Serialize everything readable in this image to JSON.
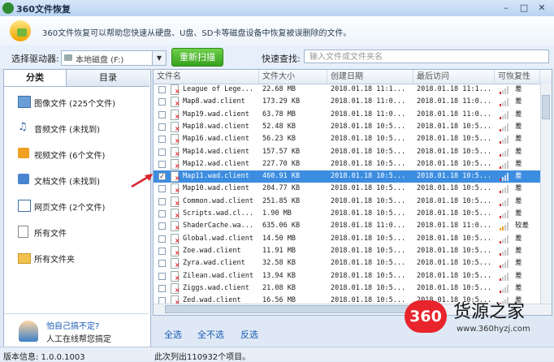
{
  "window": {
    "title": "360文件恢复",
    "min": "–",
    "max": "□",
    "close": "✕"
  },
  "banner": {
    "description": "360文件恢复可以帮助您快速从硬盘、U盘、SD卡等磁盘设备中恢复被误删除的文件。"
  },
  "toolbar": {
    "drive_label": "选择驱动器:",
    "drive_value": "本地磁盘  (F:)",
    "rescan": "重新扫描",
    "search_label": "快速查找:",
    "search_placeholder": "输入文件或文件夹名"
  },
  "tabs": [
    "分类",
    "目录"
  ],
  "categories": [
    {
      "label": "图像文件 (225个文件)",
      "icon": "image-icon"
    },
    {
      "label": "音频文件 (未找到)",
      "icon": "music-icon"
    },
    {
      "label": "视频文件 (6个文件)",
      "icon": "video-icon"
    },
    {
      "label": "文档文件 (未找到)",
      "icon": "document-icon"
    },
    {
      "label": "网页文件 (2个文件)",
      "icon": "webpage-icon"
    },
    {
      "label": "所有文件",
      "icon": "file-icon"
    },
    {
      "label": "所有文件夹",
      "icon": "folder-icon"
    }
  ],
  "help": {
    "question": "怕自己搞不定?",
    "answer": "人工在线帮您搞定"
  },
  "table": {
    "columns": [
      "文件名",
      "文件大小",
      "创建日期",
      "最后访问",
      "可恢复性"
    ],
    "rows": [
      {
        "name": "League of Lege...",
        "size": "22.68 MB",
        "created": "2018.01.18 11:1...",
        "accessed": "2018.01.18 11:1...",
        "rec": "差",
        "checked": false
      },
      {
        "name": "Map8.wad.client",
        "size": "173.29 KB",
        "created": "2018.01.18 11:0...",
        "accessed": "2018.01.18 11:0...",
        "rec": "差",
        "checked": false
      },
      {
        "name": "Map19.wad.client",
        "size": "63.78 MB",
        "created": "2018.01.18 11:0...",
        "accessed": "2018.01.18 11:0...",
        "rec": "差",
        "checked": false
      },
      {
        "name": "Map18.wad.client",
        "size": "52.48 KB",
        "created": "2018.01.18 10:5...",
        "accessed": "2018.01.18 10:5...",
        "rec": "差",
        "checked": false
      },
      {
        "name": "Map16.wad.client",
        "size": "56.23 KB",
        "created": "2018.01.18 10:5...",
        "accessed": "2018.01.18 10:5...",
        "rec": "差",
        "checked": false
      },
      {
        "name": "Map14.wad.client",
        "size": "157.57 KB",
        "created": "2018.01.18 10:5...",
        "accessed": "2018.01.18 10:5...",
        "rec": "差",
        "checked": false
      },
      {
        "name": "Map12.wad.client",
        "size": "227.70 KB",
        "created": "2018.01.18 10:5...",
        "accessed": "2018.01.18 10:5...",
        "rec": "差",
        "checked": false
      },
      {
        "name": "Map11.wad.client",
        "size": "460.91 KB",
        "created": "2018.01.18 10:5...",
        "accessed": "2018.01.18 10:5...",
        "rec": "差",
        "checked": true
      },
      {
        "name": "Map10.wad.client",
        "size": "204.77 KB",
        "created": "2018.01.18 10:5...",
        "accessed": "2018.01.18 10:5...",
        "rec": "差",
        "checked": false
      },
      {
        "name": "Common.wad.client",
        "size": "251.85 KB",
        "created": "2018.01.18 10:5...",
        "accessed": "2018.01.18 10:5...",
        "rec": "差",
        "checked": false
      },
      {
        "name": "Scripts.wad.cl...",
        "size": "1.90 MB",
        "created": "2018.01.18 10:5...",
        "accessed": "2018.01.18 10:5...",
        "rec": "差",
        "checked": false
      },
      {
        "name": "ShaderCache.wa...",
        "size": "635.06 KB",
        "created": "2018.01.18 11:0...",
        "accessed": "2018.01.18 11:0...",
        "rec": "较差",
        "checked": false
      },
      {
        "name": "Global.wad.client",
        "size": "14.50 MB",
        "created": "2018.01.18 10:5...",
        "accessed": "2018.01.18 10:5...",
        "rec": "差",
        "checked": false
      },
      {
        "name": "Zoe.wad.client",
        "size": "11.91 MB",
        "created": "2018.01.18 10:5...",
        "accessed": "2018.01.18 10:5...",
        "rec": "差",
        "checked": false
      },
      {
        "name": "Zyra.wad.client",
        "size": "32.58 KB",
        "created": "2018.01.18 10:5...",
        "accessed": "2018.01.18 10:5...",
        "rec": "差",
        "checked": false
      },
      {
        "name": "Zilean.wad.client",
        "size": "13.94 KB",
        "created": "2018.01.18 10:5...",
        "accessed": "2018.01.18 10:5...",
        "rec": "差",
        "checked": false
      },
      {
        "name": "Ziggs.wad.client",
        "size": "21.08 KB",
        "created": "2018.01.18 10:5...",
        "accessed": "2018.01.18 10:5...",
        "rec": "差",
        "checked": false
      },
      {
        "name": "Zed.wad.client",
        "size": "16.56 MB",
        "created": "2018.01.18 10:5...",
        "accessed": "2018.01.18 10:5...",
        "rec": "差",
        "checked": false
      }
    ]
  },
  "actions": {
    "select_all": "全选",
    "select_none": "全不选",
    "invert": "反选"
  },
  "status": {
    "version": "版本信息: 1.0.0.1003",
    "count": "此次列出110932个项目。"
  },
  "watermark": {
    "badge": "360",
    "text": "货源之家",
    "url": "www.360hyzj.com"
  },
  "colors": {
    "selected_row": "#3c8de0",
    "link": "#1a5bb5",
    "rescan": "#36a11d",
    "poor": "#d9262c",
    "fair": "#f0a020"
  }
}
